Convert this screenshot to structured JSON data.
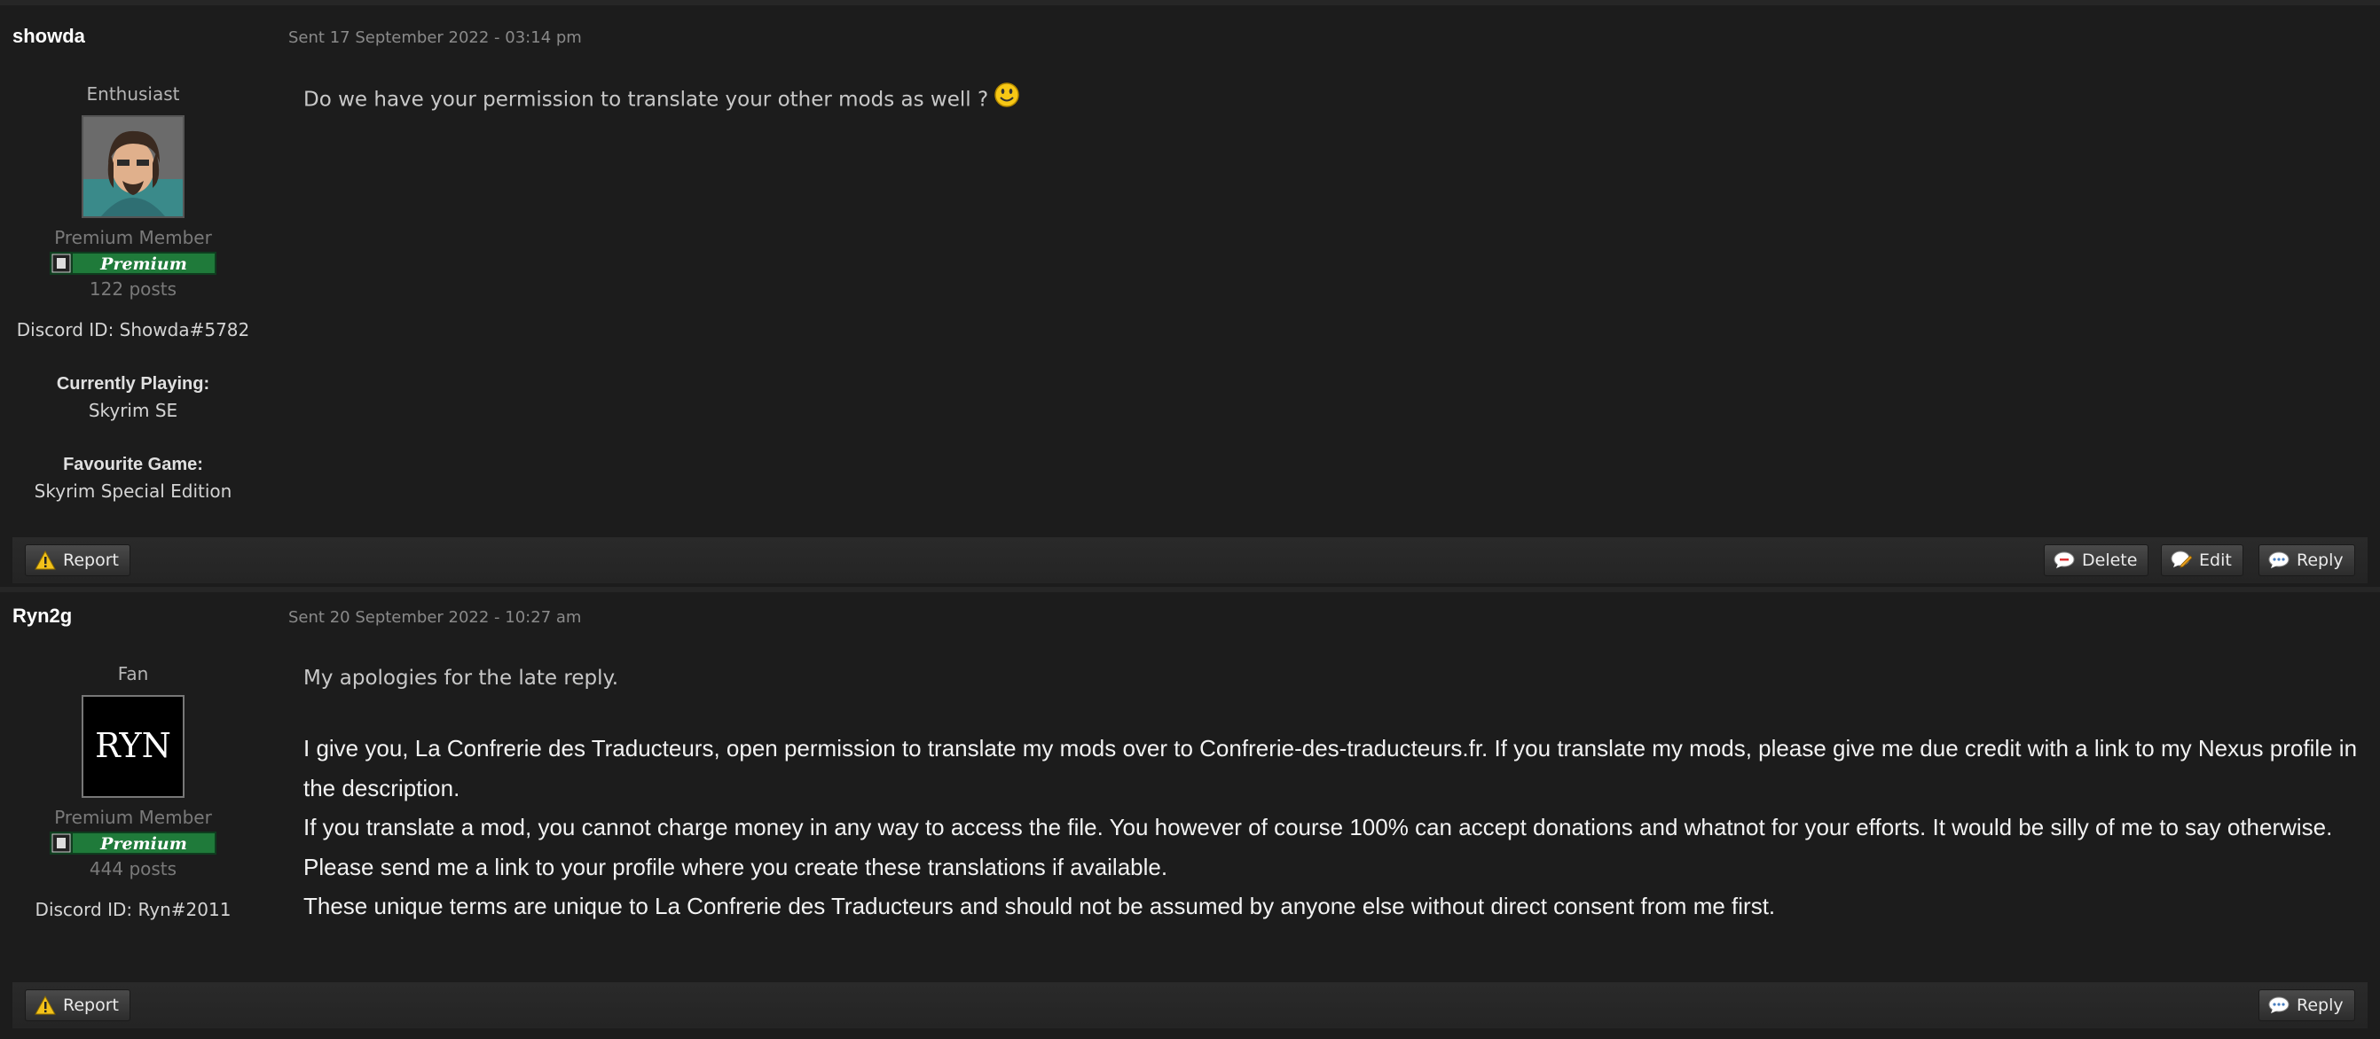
{
  "posts": [
    {
      "username": "showda",
      "sent": "Sent 17 September 2022 - 03:14 pm",
      "rank": "Enthusiast",
      "member_type": "Premium Member",
      "badge_text": "Premium",
      "posts": "122 posts",
      "discord": "Discord ID: Showda#5782",
      "currently_playing_label": "Currently Playing:",
      "currently_playing_value": "Skyrim SE",
      "favourite_game_label": "Favourite Game:",
      "favourite_game_value": "Skyrim Special Edition",
      "message": "Do we have your permission to translate your other mods as well ?",
      "smiley_icon": "smiley-icon",
      "actions": {
        "report": "Report",
        "delete": "Delete",
        "edit": "Edit",
        "reply": "Reply"
      }
    },
    {
      "username": "Ryn2g",
      "sent": "Sent 20 September 2022 - 10:27 am",
      "rank": "Fan",
      "avatar_text": "RYN",
      "member_type": "Premium Member",
      "badge_text": "Premium",
      "posts": "444 posts",
      "discord": "Discord ID: Ryn#2011",
      "intro": "My apologies for the late reply.",
      "paragraphs": [
        "I give you, La Confrerie des Traducteurs, open permission to translate my mods over to Confrerie-des-traducteurs.fr. If you translate my mods, please give me due credit with a link to my Nexus profile in the description.",
        "If you translate a mod, you cannot charge money in any way to access the file. You however of course 100% can accept donations and whatnot for your efforts. It would be silly of me to say otherwise.",
        "Please send me a link to your profile where you create these translations if available.",
        "These unique terms are unique to La Confrerie des Traducteurs and should not be assumed by anyone else without direct consent from me first."
      ],
      "actions": {
        "report": "Report",
        "reply": "Reply"
      }
    }
  ],
  "colors": {
    "background": "#1c1c1c",
    "badge_green": "#1f7a3a",
    "warning_yellow": "#f2c21a"
  }
}
